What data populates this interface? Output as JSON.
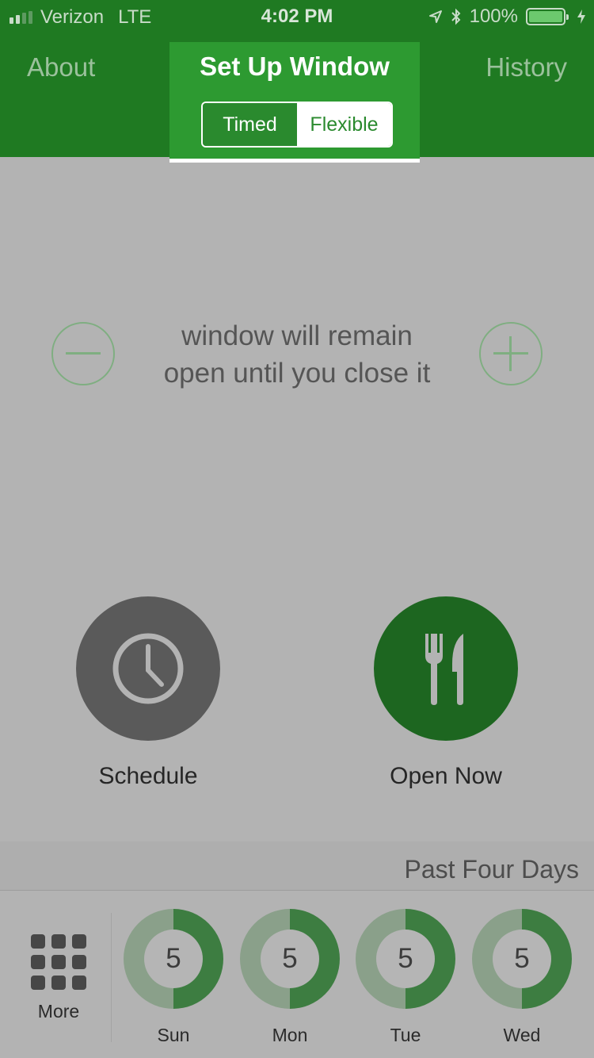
{
  "status_bar": {
    "carrier": "Verizon",
    "network": "LTE",
    "time": "4:02 PM",
    "battery": "100%",
    "icons": [
      "signal-icon",
      "location-arrow-icon",
      "bluetooth-icon",
      "battery-icon",
      "charging-bolt-icon"
    ]
  },
  "nav": {
    "left": "About",
    "title": "Set Up Window",
    "right": "History",
    "segments": [
      "Timed",
      "Flexible"
    ],
    "selected_segment": "Timed"
  },
  "main": {
    "message_line1": "window will remain",
    "message_line2": "open until you close it",
    "decrease_icon": "minus-circle-icon",
    "increase_icon": "plus-circle-icon"
  },
  "actions": {
    "schedule_label": "Schedule",
    "schedule_icon": "clock-icon",
    "open_now_label": "Open Now",
    "open_now_icon": "fork-knife-icon"
  },
  "history": {
    "header": "Past Four Days",
    "more_label": "More",
    "more_icon": "grid-icon",
    "days": [
      {
        "label": "Sun",
        "value": "5",
        "progress": 0.5
      },
      {
        "label": "Mon",
        "value": "5",
        "progress": 0.5
      },
      {
        "label": "Tue",
        "value": "5",
        "progress": 0.5
      },
      {
        "label": "Wed",
        "value": "5",
        "progress": 0.5
      }
    ]
  },
  "colors": {
    "brand_green": "#1f7a22",
    "nav_highlight": "#2d9a31",
    "open_now_green": "#1d6620",
    "schedule_gray": "#5a5a5a",
    "overlay_gray": "#b3b3b3"
  }
}
